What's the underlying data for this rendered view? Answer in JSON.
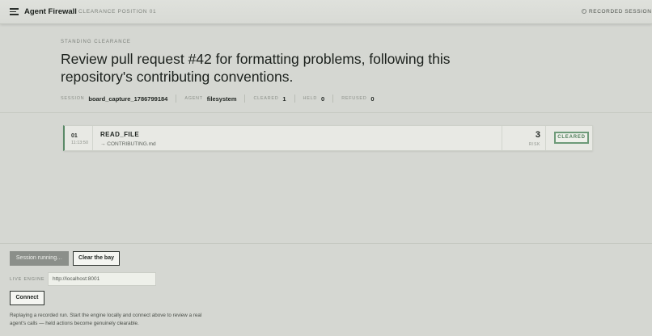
{
  "header": {
    "app_title": "Agent Firewall",
    "clearance_position": "CLEARANCE POSITION 01",
    "recorded_label": "RECORDED SESSION",
    "icons": {
      "menu": "menu-icon",
      "recorded": "record-dot-icon"
    }
  },
  "clearance": {
    "eyebrow": "STANDING CLEARANCE",
    "headline": "Review pull request #42 for formatting problems, following this repository's contributing conventions.",
    "meta": {
      "session_label": "SESSION",
      "session_value": "board_capture_1786799184",
      "agent_label": "AGENT",
      "agent_value": "filesystem",
      "cleared_label": "CLEARED",
      "cleared_value": "1",
      "held_label": "HELD",
      "held_value": "0",
      "refused_label": "REFUSED",
      "refused_value": "0"
    }
  },
  "calls": [
    {
      "index": "01",
      "time": "11:13:50",
      "action": "READ_FILE",
      "target": "→ CONTRIBUTING.md",
      "risk": "3",
      "risk_label": "RISK",
      "status": "CLEARED",
      "status_color": "#4e7d5a"
    }
  ],
  "controls": {
    "running_label": "Session running…",
    "clear_label": "Clear the bay",
    "engine_label": "LIVE ENGINE",
    "engine_value": "http://localhost:8001",
    "connect_label": "Connect",
    "note": "Replaying a recorded run. Start the engine locally and connect above to review a real agent's calls — held actions become genuinely clearable."
  },
  "colors": {
    "background": "#d5d7d2",
    "accent_green": "#5b8a68",
    "button_dark": "#8b8f8a"
  }
}
